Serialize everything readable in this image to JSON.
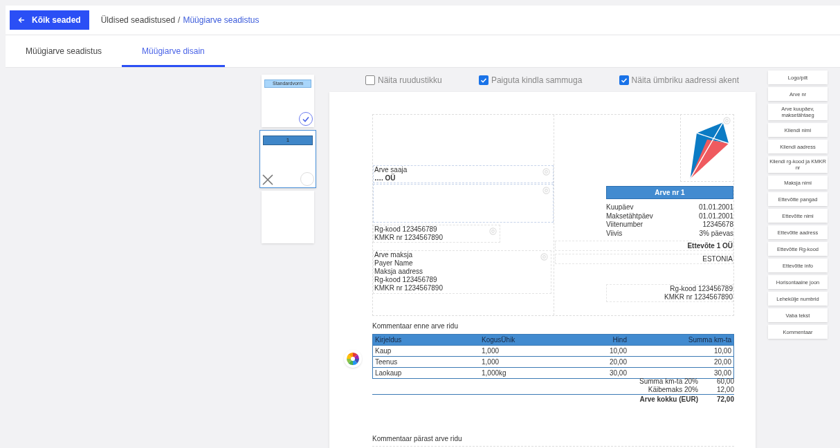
{
  "back_button": {
    "label": "Kõik seaded"
  },
  "breadcrumb": [
    {
      "label": "Üldised seadistused",
      "current": false
    },
    {
      "label": "Müügiarve seadistus",
      "current": true
    }
  ],
  "breadcrumb_separator": "/",
  "tabs": [
    {
      "label": "Müügiarve seadistus",
      "selected": false
    },
    {
      "label": "Müügiarve disain",
      "selected": true
    }
  ],
  "templates": [
    {
      "kind": "default",
      "label": "Standardvorm",
      "selected": false,
      "checked": true
    },
    {
      "kind": "custom",
      "label": "1",
      "selected": true,
      "checked": false
    },
    {
      "kind": "blank",
      "selected": false
    }
  ],
  "options": [
    {
      "label": "Näita ruudustikku",
      "checked": false
    },
    {
      "label": "Paiguta kindla sammuga",
      "checked": true
    },
    {
      "label": "Näita ümbriku aadressi akent",
      "checked": true
    }
  ],
  "elements": [
    "Logo/pilt",
    "Arve nr",
    "Arve kuupäev, maksetähtaeg",
    "Kliendi nimi",
    "Kliendi aadress",
    "Kliendi rg-kood ja KMKR nr",
    "Maksja nimi",
    "Ettevõtte pangad",
    "Ettevõtte nimi",
    "Ettevõtte aadress",
    "Ettevõtte Rg-kood",
    "Ettevõtte info",
    "Horisontaalne joon",
    "Lehekülje numbrid",
    "Vaba tekst",
    "Kommentaar"
  ],
  "invoice": {
    "recipient_heading": "Arve saaja",
    "recipient_name": "…. OÜ",
    "client_codes": [
      "Rg-kood 123456789",
      "KMKR nr 1234567890"
    ],
    "payer": [
      "Arve maksja",
      "Payer Name",
      "Maksja aadress",
      "Rg-kood 123456789",
      "KMKR nr 1234567890"
    ],
    "title": "Arve nr 1",
    "details": [
      {
        "label": "Kuupäev",
        "value": "01.01.2001"
      },
      {
        "label": "Maksetähtpäev",
        "value": "01.01.2001"
      },
      {
        "label": "Viitenumber",
        "value": "12345678"
      },
      {
        "label": "Viivis",
        "value": "3% päevas"
      }
    ],
    "company_name": "Ettevõte 1 OÜ",
    "company_country": "ESTONIA",
    "company_codes": [
      "Rg-kood 123456789",
      "KMKR nr 1234567890"
    ],
    "comment_before": "Kommentaar enne arve ridu",
    "table": {
      "columns": [
        "Kirjeldus",
        "KogusÜhik",
        "Hind",
        "Summa km-ta"
      ],
      "rows": [
        [
          "Kaup",
          "1,000",
          "10,00",
          "10,00"
        ],
        [
          "Teenus",
          "1,000",
          "20,00",
          "20,00"
        ],
        [
          "Laokaup",
          "1,000kg",
          "30,00",
          "30,00"
        ]
      ]
    },
    "totals": [
      {
        "kind": "sub",
        "label": "Summa km-ta 20%",
        "value": "60,00"
      },
      {
        "kind": "sub",
        "label": "Käibemaks 20%",
        "value": "12,00"
      },
      {
        "kind": "grand",
        "label": "Arve kokku (EUR)",
        "value": "72,00"
      }
    ],
    "comment_after": "Kommentaar pärast arve ridu"
  }
}
